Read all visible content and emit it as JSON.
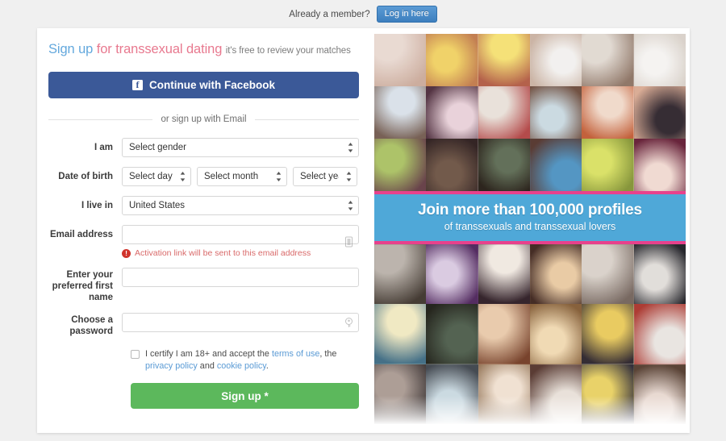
{
  "topbar": {
    "prompt": "Already a member?",
    "login_label": "Log in here"
  },
  "heading": {
    "part_blue": "Sign up",
    "part_pink": "for transsexual dating",
    "subtitle": "it's free to review your matches"
  },
  "social": {
    "facebook_label": "Continue with Facebook",
    "facebook_glyph": "f",
    "facebook_color": "#3b5998"
  },
  "divider": {
    "text": "or sign up with Email"
  },
  "form": {
    "gender": {
      "label": "I am",
      "value": "Select gender"
    },
    "dob": {
      "label": "Date of birth",
      "day": "Select day",
      "month": "Select month",
      "year": "Select year"
    },
    "country": {
      "label": "I live in",
      "value": "United States"
    },
    "email": {
      "label": "Email address",
      "value": "",
      "placeholder": "",
      "hint": "Activation link will be sent to this email address",
      "hint_icon_char": "!"
    },
    "firstname": {
      "label": "Enter your preferred first name",
      "value": "",
      "placeholder": ""
    },
    "password": {
      "label": "Choose a password",
      "value": "",
      "placeholder": ""
    }
  },
  "terms": {
    "checked": false,
    "text_before": "I certify I am 18+ and accept the ",
    "link_terms": "terms of use",
    "text_mid1": ", the ",
    "link_privacy": "privacy policy",
    "text_mid2": " and ",
    "link_cookie": "cookie policy",
    "text_end": "."
  },
  "submit": {
    "label": "Sign up *",
    "color": "#5cb85c"
  },
  "banner": {
    "title": "Join more than 100,000 profiles",
    "subtitle": "of transsexuals and transsexual lovers",
    "bg_color": "#4fa8d8",
    "border_color": "#e8418c"
  },
  "photos": {
    "top_grid": [
      {
        "c1": "#e8d8d0",
        "c2": "#c9a898"
      },
      {
        "c1": "#f0d060",
        "c2": "#c07848"
      },
      {
        "c1": "#f5e070",
        "c2": "#b05840"
      },
      {
        "c1": "#f2f0ee",
        "c2": "#c8b0a0"
      },
      {
        "c1": "#e0d8d0",
        "c2": "#8a7060"
      },
      {
        "c1": "#f5f3f1",
        "c2": "#d8d0c8"
      },
      {
        "c1": "#d8e0e8",
        "c2": "#70584c"
      },
      {
        "c1": "#e8d0d8",
        "c2": "#4a2838"
      },
      {
        "c1": "#e8e0d8",
        "c2": "#b04040"
      },
      {
        "c1": "#c8d8e0",
        "c2": "#6a4838"
      },
      {
        "c1": "#f0d8c8",
        "c2": "#c05830"
      },
      {
        "c1": "#2a2028",
        "c2": "#d8a890"
      },
      {
        "c1": "#a8c060",
        "c2": "#603840"
      },
      {
        "c1": "#6a5040",
        "c2": "#281818"
      },
      {
        "c1": "#5a6850",
        "c2": "#201810"
      },
      {
        "c1": "#4a90c0",
        "c2": "#503028"
      },
      {
        "c1": "#d8e060",
        "c2": "#809030"
      },
      {
        "c1": "#f0d8d0",
        "c2": "#601830"
      }
    ],
    "bottom_grid": [
      {
        "c1": "#b8b0a8",
        "c2": "#3a3028"
      },
      {
        "c1": "#d8c8e0",
        "c2": "#4a2058"
      },
      {
        "c1": "#f0e8e0",
        "c2": "#2a1820"
      },
      {
        "c1": "#e8c8a0",
        "c2": "#3a2018"
      },
      {
        "c1": "#d8d0c8",
        "c2": "#706058"
      },
      {
        "c1": "#e0dcd8",
        "c2": "#1a1a20"
      },
      {
        "c1": "#f0e8c0",
        "c2": "#3a6880"
      },
      {
        "c1": "#4a5a48",
        "c2": "#181810"
      },
      {
        "c1": "#e8c8a8",
        "c2": "#703820"
      },
      {
        "c1": "#f0d8b0",
        "c2": "#805830"
      },
      {
        "c1": "#e8c858",
        "c2": "#282028"
      },
      {
        "c1": "#e8e4e0",
        "c2": "#a83028"
      },
      {
        "c1": "#a89890",
        "c2": "#302828"
      },
      {
        "c1": "#c8d8e0",
        "c2": "#3a4048"
      },
      {
        "c1": "#f0e0d0",
        "c2": "#8a6848"
      },
      {
        "c1": "#e8e0d8",
        "c2": "#503028"
      },
      {
        "c1": "#e8d060",
        "c2": "#282430"
      },
      {
        "c1": "#e8d8d0",
        "c2": "#50382a"
      }
    ]
  }
}
